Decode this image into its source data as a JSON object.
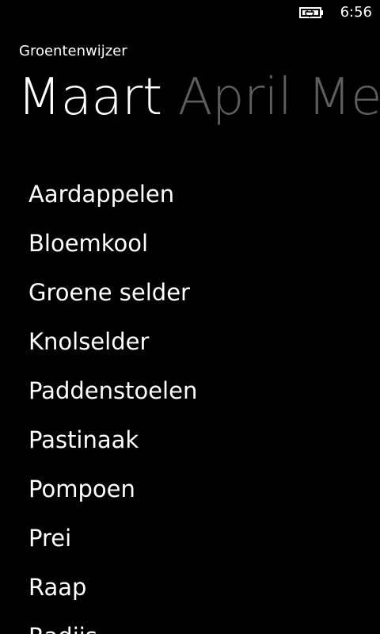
{
  "status_bar": {
    "time": "6:56",
    "battery_icon": "battery-charging-icon"
  },
  "app": {
    "title": "Groentenwijzer"
  },
  "pivot": {
    "headers": [
      "Maart",
      "April",
      "Mei"
    ],
    "active_index": 0
  },
  "vegetables": [
    "Aardappelen",
    "Bloemkool",
    "Groene selder",
    "Knolselder",
    "Paddenstoelen",
    "Pastinaak",
    "Pompoen",
    "Prei",
    "Raap",
    "Radijs"
  ],
  "colors": {
    "background": "#000000",
    "foreground": "#ffffff",
    "inactive_header": "#5e5e5e"
  }
}
